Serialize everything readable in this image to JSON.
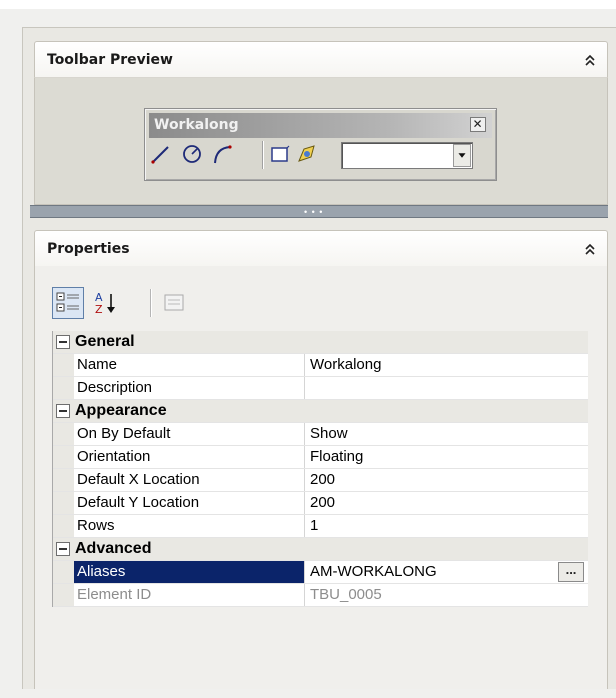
{
  "toolbar_preview": {
    "title": "Toolbar Preview",
    "window_title": "Workalong",
    "icons": [
      "line-icon",
      "circle-icon",
      "arc-icon",
      "rectangle-icon",
      "feature-icon"
    ],
    "combo_value": ""
  },
  "properties": {
    "title": "Properties",
    "toolbar": [
      "categorized-icon",
      "alphabetical-icon",
      "property-pages-icon"
    ],
    "categories": [
      {
        "label": "General",
        "rows": [
          {
            "name": "Name",
            "value": "Workalong"
          },
          {
            "name": "Description",
            "value": ""
          }
        ]
      },
      {
        "label": "Appearance",
        "rows": [
          {
            "name": "On By Default",
            "value": "Show"
          },
          {
            "name": "Orientation",
            "value": "Floating"
          },
          {
            "name": "Default X Location",
            "value": "200"
          },
          {
            "name": "Default Y Location",
            "value": "200"
          },
          {
            "name": "Rows",
            "value": "1"
          }
        ]
      },
      {
        "label": "Advanced",
        "rows": [
          {
            "name": "Aliases",
            "value": "AM-WORKALONG",
            "selected": true,
            "button": "..."
          },
          {
            "name": "Element ID",
            "value": "TBU_0005",
            "readonly": true
          }
        ]
      }
    ]
  },
  "colors": {
    "selection": "#0b246a",
    "panel_bg": "#e9e8e3",
    "splitter": "#9aa3ad"
  }
}
